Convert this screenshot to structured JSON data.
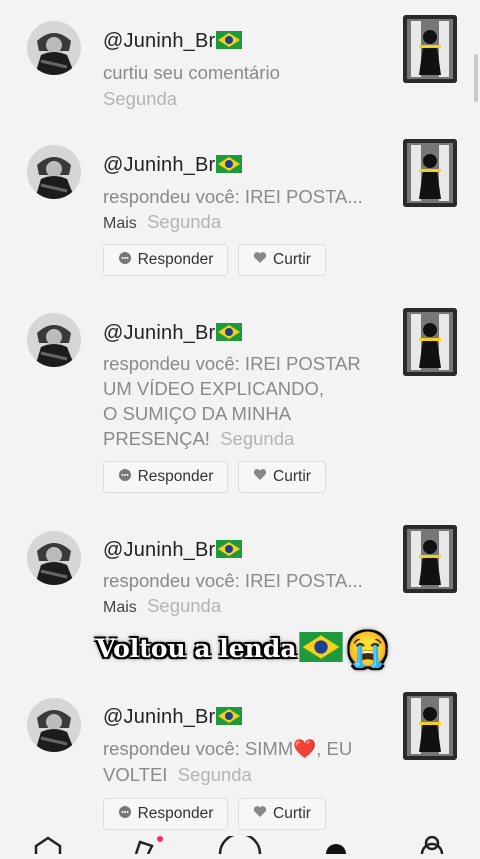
{
  "notifications": [
    {
      "username": "@Juninh_Br",
      "text": "curtiu seu comentário",
      "time": "Segunda",
      "more": "",
      "buttons": false
    },
    {
      "username": "@Juninh_Br",
      "text": "respondeu você: IREI POSTA...",
      "time": "Segunda",
      "more": "Mais",
      "buttons": true
    },
    {
      "username": "@Juninh_Br",
      "lines": [
        "respondeu você: IREI POSTAR",
        "UM VÍDEO EXPLICANDO,",
        "O SUMIÇO DA MINHA",
        "PRESENÇA!"
      ],
      "time": "Segunda",
      "buttons": true
    },
    {
      "username": "@Juninh_Br",
      "text": "respondeu você: IREI POSTA...",
      "time": "Segunda",
      "more": "Mais",
      "buttons": false
    },
    {
      "username": "@Juninh_Br",
      "lines": [
        "respondeu você: SIMM❤️, EU",
        "VOLTEI"
      ],
      "time": "Segunda",
      "buttons": true
    }
  ],
  "buttons": {
    "reply": "Responder",
    "like": "Curtir"
  },
  "overlay": {
    "text": "Voltou a lenda",
    "emoji": "😭"
  },
  "colors": {
    "background": "#f3f3f3",
    "muted": "#8a8a8a",
    "flag_green": "#1e9a3c",
    "flag_yellow": "#f7d117",
    "flag_blue": "#1c3f94"
  }
}
